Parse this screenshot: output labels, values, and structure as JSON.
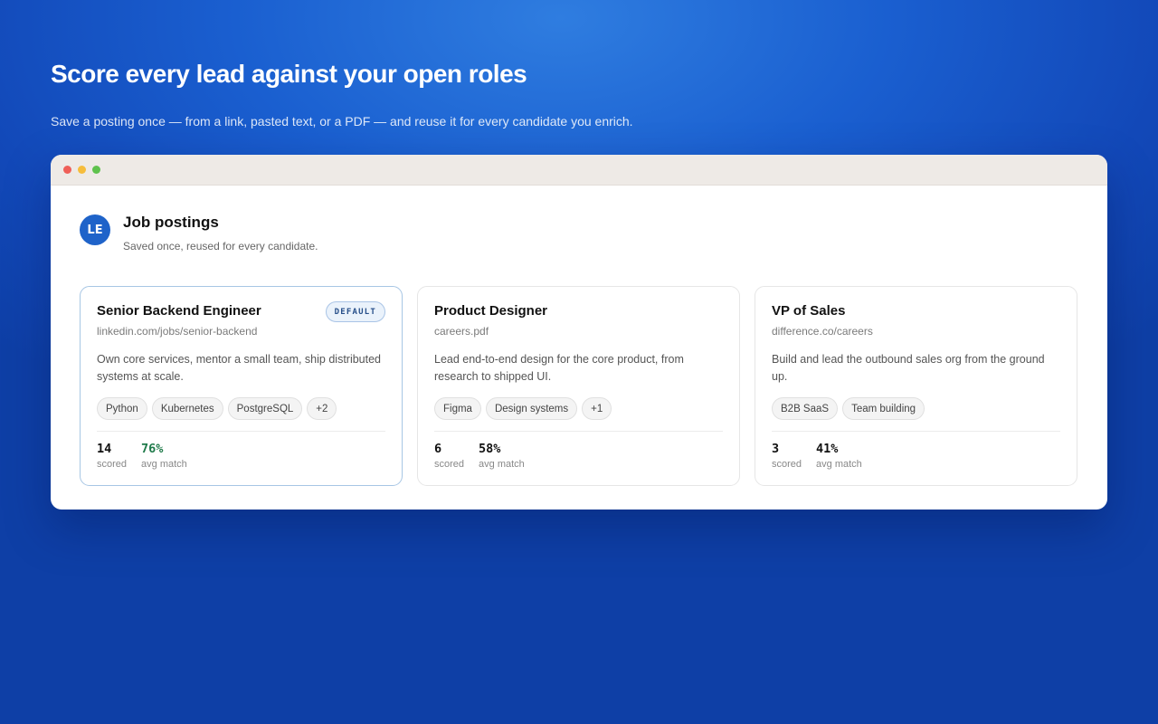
{
  "hero": {
    "title": "Score every lead against your open roles",
    "subtitle": "Save a posting once — from a link, pasted text, or a PDF — and reuse it for every candidate you enrich."
  },
  "app": {
    "logo_text": "LE",
    "title": "Job postings",
    "subtitle": "Saved once, reused for every candidate."
  },
  "colors": {
    "accent": "#1f63c9",
    "good_match": "#1f7a4a"
  },
  "cards": [
    {
      "title": "Senior Backend Engineer",
      "source": "linkedin.com/jobs/senior-backend",
      "badge": "DEFAULT",
      "description": "Own core services, mentor a small team, ship distributed systems at scale.",
      "tags": [
        "Python",
        "Kubernetes",
        "PostgreSQL",
        "+2"
      ],
      "scored_value": "14",
      "scored_label": "scored",
      "match_value": "76%",
      "match_label": "avg match"
    },
    {
      "title": "Product Designer",
      "source": "careers.pdf",
      "description": "Lead end-to-end design for the core product, from research to shipped UI.",
      "tags": [
        "Figma",
        "Design systems",
        "+1"
      ],
      "scored_value": "6",
      "scored_label": "scored",
      "match_value": "58%",
      "match_label": "avg match"
    },
    {
      "title": "VP of Sales",
      "source": "difference.co/careers",
      "description": "Build and lead the outbound sales org from the ground up.",
      "tags": [
        "B2B SaaS",
        "Team building"
      ],
      "scored_value": "3",
      "scored_label": "scored",
      "match_value": "41%",
      "match_label": "avg match"
    }
  ]
}
